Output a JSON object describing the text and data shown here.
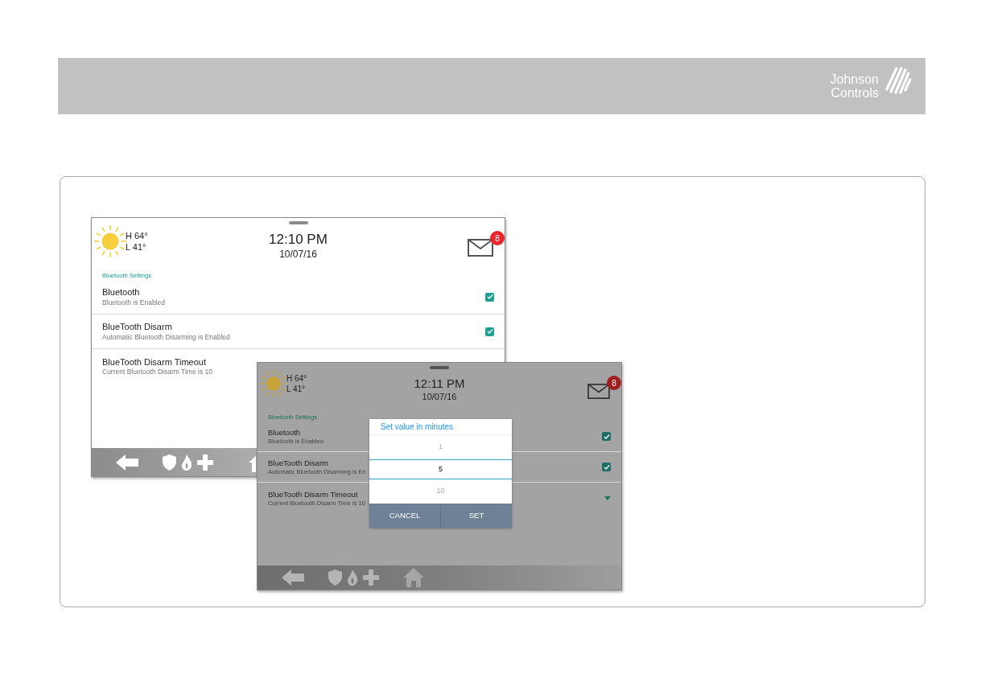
{
  "logo": {
    "lines": [
      "Johnson",
      "Controls"
    ]
  },
  "screens": [
    {
      "dimmed": false,
      "weather": {
        "high": "H 64°",
        "low": "L 41°"
      },
      "time": "12:10 PM",
      "date": "10/07/16",
      "mail_badge": "8",
      "section": "Bluetooth Settings",
      "rows": [
        {
          "title": "Bluetooth",
          "subtitle": "Bluetooth is Enabled",
          "kind": "checkbox",
          "checked": true
        },
        {
          "title": "BlueTooth Disarm",
          "subtitle": "Automatic Bluetooth Disarming is Enabled",
          "kind": "checkbox",
          "checked": true
        },
        {
          "title": "BlueTooth Disarm Timeout",
          "subtitle": "Current Bluetooth Disarm Time is 10",
          "kind": "text"
        }
      ]
    },
    {
      "dimmed": true,
      "weather": {
        "high": "H 64°",
        "low": "L 41°"
      },
      "time": "12:11 PM",
      "date": "10/07/16",
      "mail_badge": "8",
      "section": "Bluetooth Settings",
      "rows": [
        {
          "title": "Bluetooth",
          "subtitle": "Bluetooth is Enabled",
          "kind": "checkbox",
          "checked": true
        },
        {
          "title": "BlueTooth Disarm",
          "subtitle": "Automatic Bluetooth Disarming is En",
          "kind": "checkbox",
          "checked": true
        },
        {
          "title": "BlueTooth Disarm Timeout",
          "subtitle": "Current Bluetooth Disarm Time is 10",
          "kind": "dropdown"
        }
      ],
      "dialog": {
        "title": "Set value in minutes",
        "values": [
          {
            "label": "1",
            "selected": false
          },
          {
            "label": "5",
            "selected": true
          },
          {
            "label": "10",
            "selected": false
          }
        ],
        "buttons": [
          "CANCEL",
          "SET"
        ]
      }
    }
  ]
}
